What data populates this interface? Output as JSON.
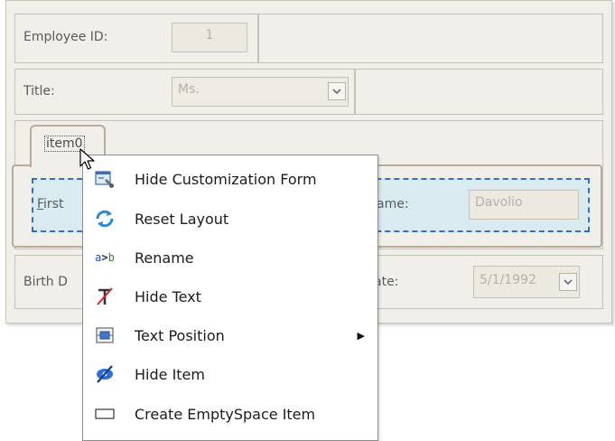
{
  "form": {
    "employee_id_label": "Employee ID:",
    "employee_id_value": "1",
    "title_label": "Title:",
    "title_value": "Ms.",
    "first_name_label_partial": "First",
    "first_name_hotkey": "F",
    "first_name_rest": "irst",
    "last_name_label_partial": "ame:",
    "last_name_value": "Davolio",
    "birth_label_partial": "Birth D",
    "hire_label_partial": "ate:",
    "hire_date_value": "5/1/1992"
  },
  "tab": {
    "label": "item0"
  },
  "context_menu": {
    "items": [
      {
        "label": "Hide Customization Form",
        "icon": "customization-form-icon"
      },
      {
        "label": "Reset Layout",
        "icon": "reset-layout-icon"
      },
      {
        "label": "Rename",
        "icon": "rename-icon",
        "icon_text_a": "a",
        "icon_text_arrow": ">",
        "icon_text_b": "b"
      },
      {
        "label": "Hide Text",
        "icon": "hide-text-icon"
      },
      {
        "label": "Text Position",
        "icon": "text-position-icon",
        "has_submenu": true
      },
      {
        "label": "Hide Item",
        "icon": "hide-item-icon"
      },
      {
        "label": "Create EmptySpace Item",
        "icon": "empty-space-icon"
      }
    ]
  },
  "colors": {
    "form_bg": "#f1efe9",
    "selection_border": "#2f6fcf",
    "selection_fill": "#d9ebf0",
    "group_border": "#b8ab98"
  }
}
